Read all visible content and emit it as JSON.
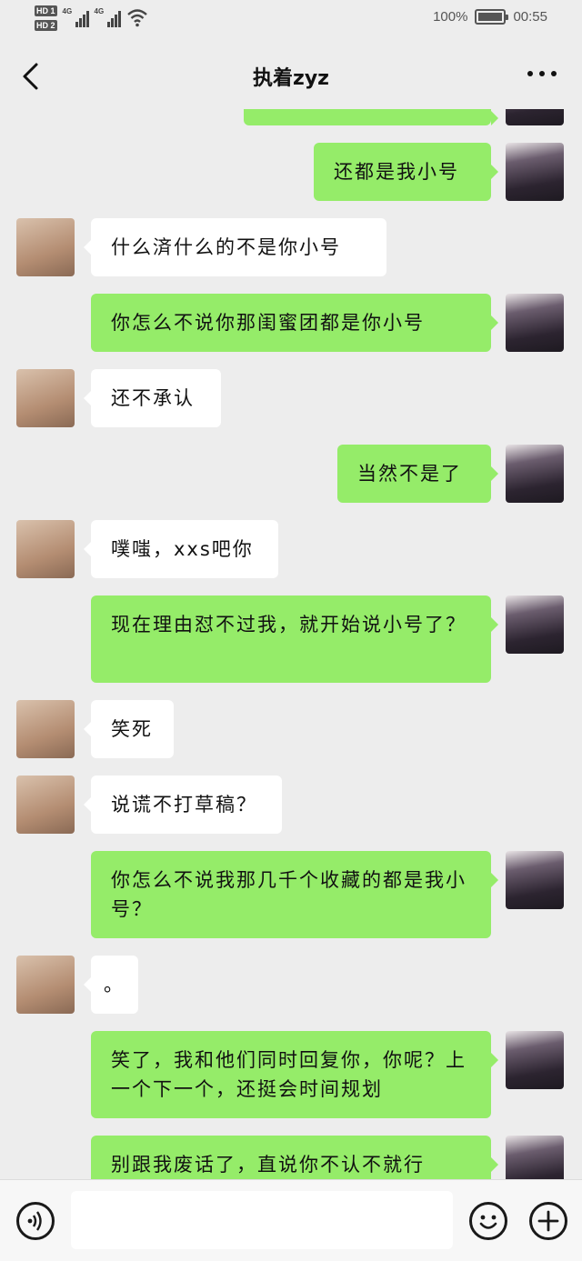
{
  "status_bar": {
    "sim1_label": "HD 1",
    "sim2_label": "HD 2",
    "network1": "4G",
    "network2": "4G",
    "battery_percent": "100%",
    "time": "00:55"
  },
  "header": {
    "title": "执着zyz",
    "back_icon": "chevron-left-icon",
    "more_icon": "more-dots-icon"
  },
  "messages": [
    {
      "side": "right",
      "text": ""
    },
    {
      "side": "right",
      "text": "还都是我小号"
    },
    {
      "side": "left",
      "text": "什么済什么的不是你小号"
    },
    {
      "side": "right",
      "text": "你怎么不说你那闺蜜团都是你小号"
    },
    {
      "side": "left",
      "text": "还不承认"
    },
    {
      "side": "right",
      "text": "当然不是了"
    },
    {
      "side": "left",
      "text": "噗嗤，xxs吧你"
    },
    {
      "side": "right",
      "text": "现在理由怼不过我，就开始说小号了？"
    },
    {
      "side": "left",
      "text": "笑死"
    },
    {
      "side": "left",
      "text": "说谎不打草稿？"
    },
    {
      "side": "right",
      "text": "你怎么不说我那几千个收藏的都是我小号？"
    },
    {
      "side": "left",
      "text": "。"
    },
    {
      "side": "right",
      "text": "笑了，我和他们同时回复你，你呢？上一个下一个，还挺会时间规划"
    },
    {
      "side": "right",
      "text": "别跟我废话了，直说你不认不就行"
    }
  ],
  "input_bar": {
    "voice_icon": "voice-icon",
    "input_value": "",
    "emoji_icon": "emoji-icon",
    "plus_icon": "plus-icon"
  },
  "colors": {
    "background": "#ededed",
    "bubble_self": "#95ec69",
    "bubble_other": "#ffffff"
  }
}
